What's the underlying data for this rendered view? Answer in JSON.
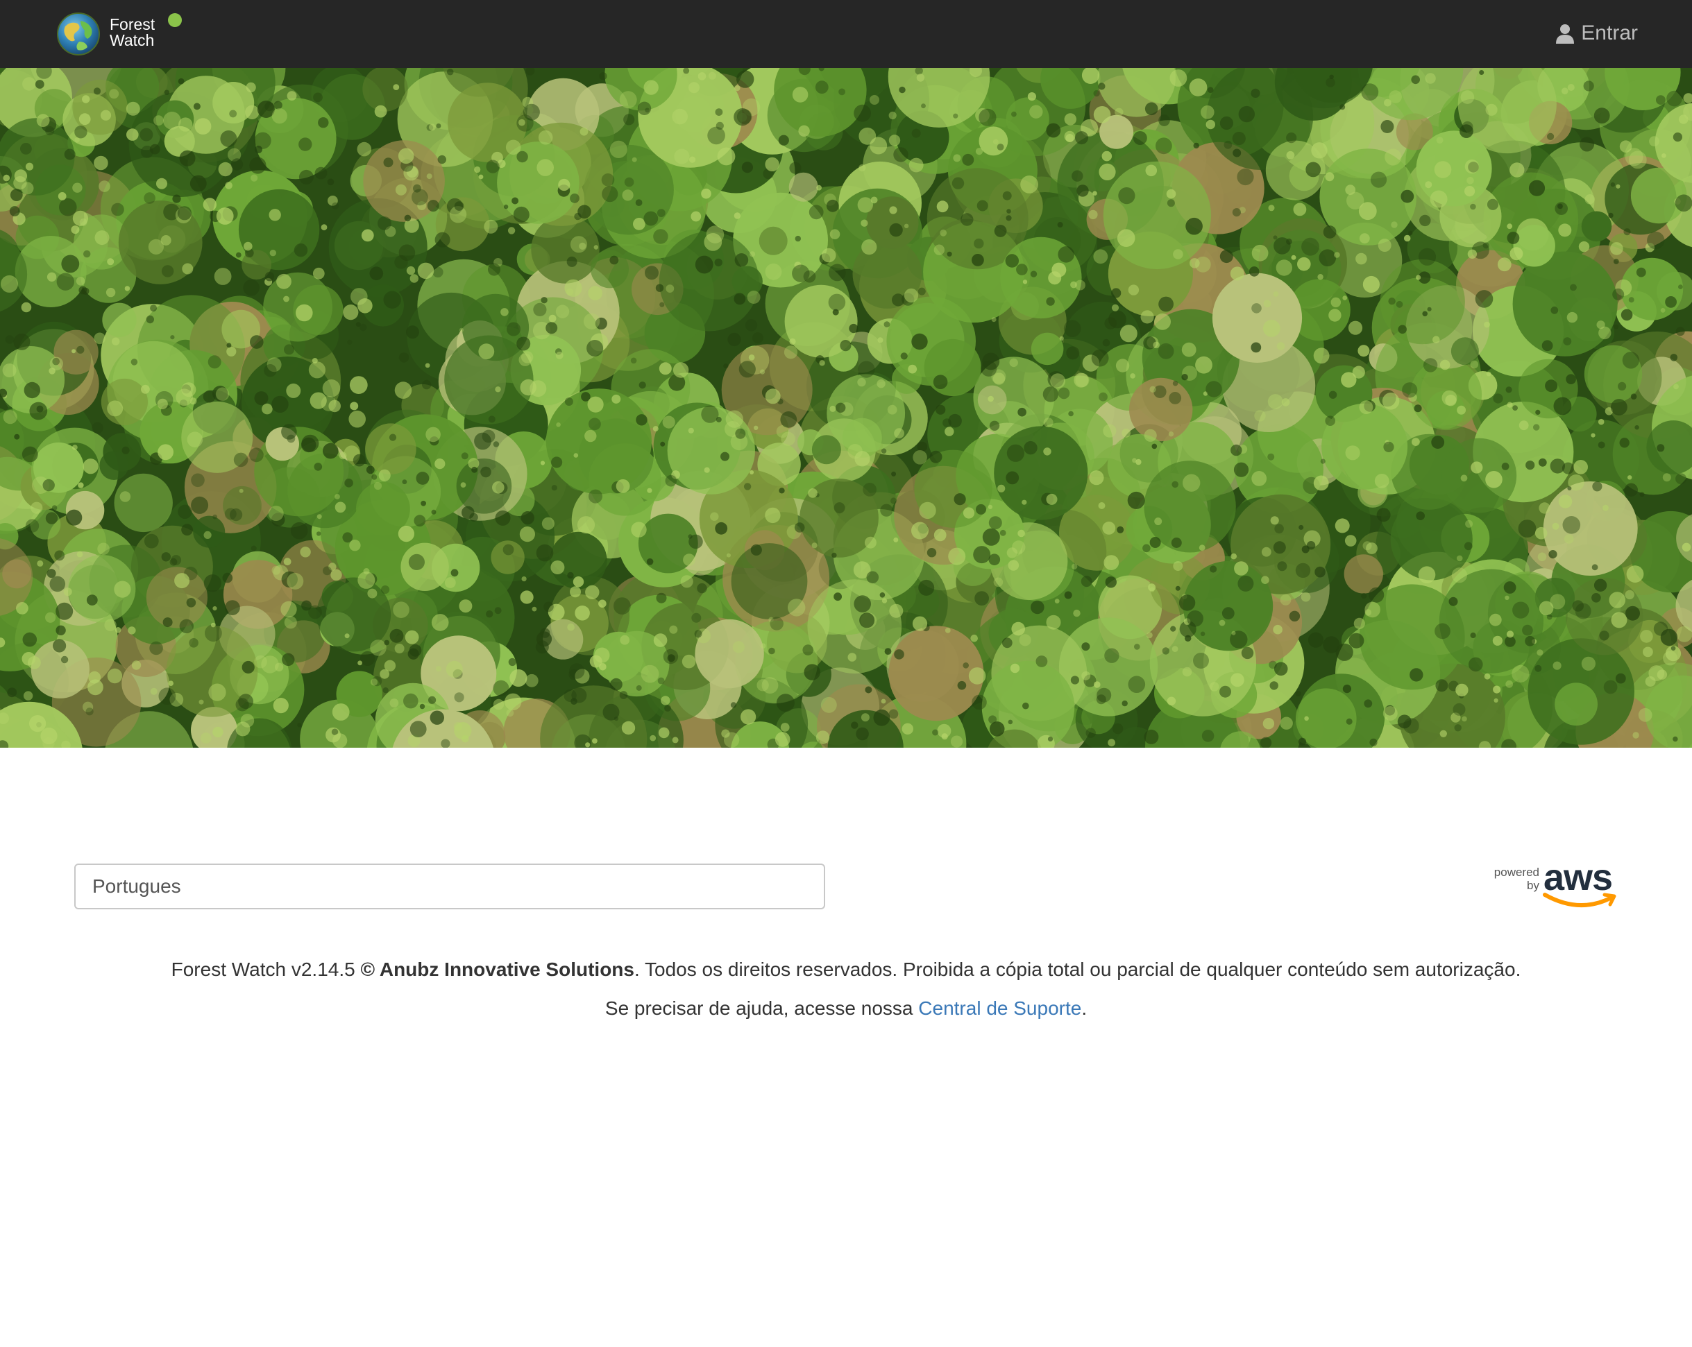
{
  "header": {
    "logo_line1": "Forest",
    "logo_line2": "Watch",
    "status_color": "#8bc34a",
    "login_label": "Entrar",
    "login_icon": "user-icon"
  },
  "hero": {
    "image": "aerial forest canopy photo"
  },
  "language_select": {
    "value": "Portugues"
  },
  "aws_badge": {
    "powered": "powered",
    "by": "by",
    "brand": "aws"
  },
  "footer": {
    "version": "Forest Watch v2.14.5 ",
    "company": "© Anubz Innovative Solutions",
    "rights": ". Todos os direitos reservados. Proibida a cópia total ou parcial de qualquer conteúdo sem autorização.",
    "help_prefix": "Se precisar de ajuda, acesse nossa ",
    "help_link": "Central de Suporte",
    "help_suffix": "."
  },
  "colors": {
    "navbar": "#262626",
    "link": "#3a78b7",
    "aws_smile": "#ff9900"
  }
}
